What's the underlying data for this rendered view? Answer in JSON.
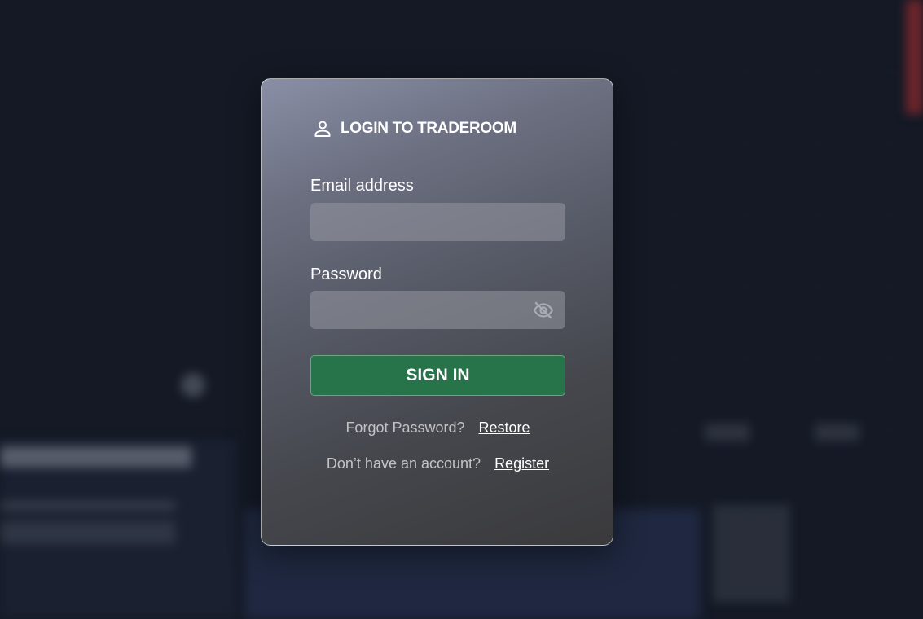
{
  "login": {
    "title": "LOGIN TO TRADEROOM",
    "email_label": "Email address",
    "email_value": "",
    "password_label": "Password",
    "password_value": "",
    "signin_label": "SIGN IN",
    "forgot_text": "Forgot Password?",
    "restore_link": "Restore",
    "no_account_text": "Don’t have an account?",
    "register_link": "Register"
  },
  "icons": {
    "header": "user-icon",
    "password_toggle": "eye-off-icon"
  },
  "colors": {
    "signin_button": "#28744a",
    "background": "#141925"
  }
}
